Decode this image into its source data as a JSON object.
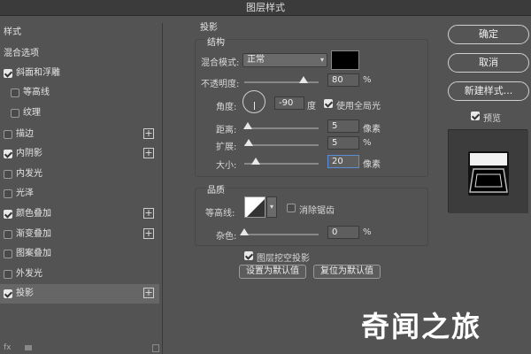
{
  "window": {
    "title": "图层样式"
  },
  "left_panel": {
    "header": "样式",
    "items": [
      {
        "label": "混合选项",
        "checkbox": false,
        "checked": false,
        "plus": false,
        "indent": false
      },
      {
        "label": "斜面和浮雕",
        "checkbox": true,
        "checked": true,
        "plus": false,
        "indent": false
      },
      {
        "label": "等高线",
        "checkbox": true,
        "checked": false,
        "plus": false,
        "indent": true
      },
      {
        "label": "纹理",
        "checkbox": true,
        "checked": false,
        "plus": false,
        "indent": true
      },
      {
        "label": "描边",
        "checkbox": true,
        "checked": false,
        "plus": true,
        "indent": false
      },
      {
        "label": "内阴影",
        "checkbox": true,
        "checked": true,
        "plus": true,
        "indent": false
      },
      {
        "label": "内发光",
        "checkbox": true,
        "checked": false,
        "plus": false,
        "indent": false
      },
      {
        "label": "光泽",
        "checkbox": true,
        "checked": false,
        "plus": false,
        "indent": false
      },
      {
        "label": "颜色叠加",
        "checkbox": true,
        "checked": true,
        "plus": true,
        "indent": false
      },
      {
        "label": "渐变叠加",
        "checkbox": true,
        "checked": false,
        "plus": true,
        "indent": false
      },
      {
        "label": "图案叠加",
        "checkbox": true,
        "checked": false,
        "plus": false,
        "indent": false
      },
      {
        "label": "外发光",
        "checkbox": true,
        "checked": false,
        "plus": false,
        "indent": false
      },
      {
        "label": "投影",
        "checkbox": true,
        "checked": true,
        "plus": true,
        "indent": false,
        "selected": true
      }
    ],
    "bottom_fx": "fx"
  },
  "drop_shadow": {
    "title": "投影",
    "structure": {
      "title": "结构",
      "blend_mode_label": "混合模式:",
      "blend_mode_value": "正常",
      "shadow_color": "#000000",
      "opacity_label": "不透明度:",
      "opacity_value": "80",
      "opacity_unit": "%",
      "angle_label": "角度:",
      "angle_value": "-90",
      "angle_unit": "度",
      "global_light_label": "使用全局光",
      "global_light_checked": true,
      "distance_label": "距离:",
      "distance_value": "5",
      "distance_unit": "像素",
      "spread_label": "扩展:",
      "spread_value": "5",
      "spread_unit": "%",
      "size_label": "大小:",
      "size_value": "20",
      "size_unit": "像素"
    },
    "quality": {
      "title": "品质",
      "contour_label": "等高线:",
      "antialias_label": "消除锯齿",
      "antialias_checked": false,
      "noise_label": "杂色:",
      "noise_value": "0",
      "noise_unit": "%"
    },
    "knockout_label": "图层挖空投影",
    "knockout_checked": true,
    "set_default_label": "设置为默认值",
    "reset_default_label": "复位为默认值"
  },
  "actions": {
    "ok": "确定",
    "cancel": "取消",
    "new_style": "新建样式...",
    "preview_label": "预览",
    "preview_checked": true
  },
  "watermark": "奇闻之旅"
}
